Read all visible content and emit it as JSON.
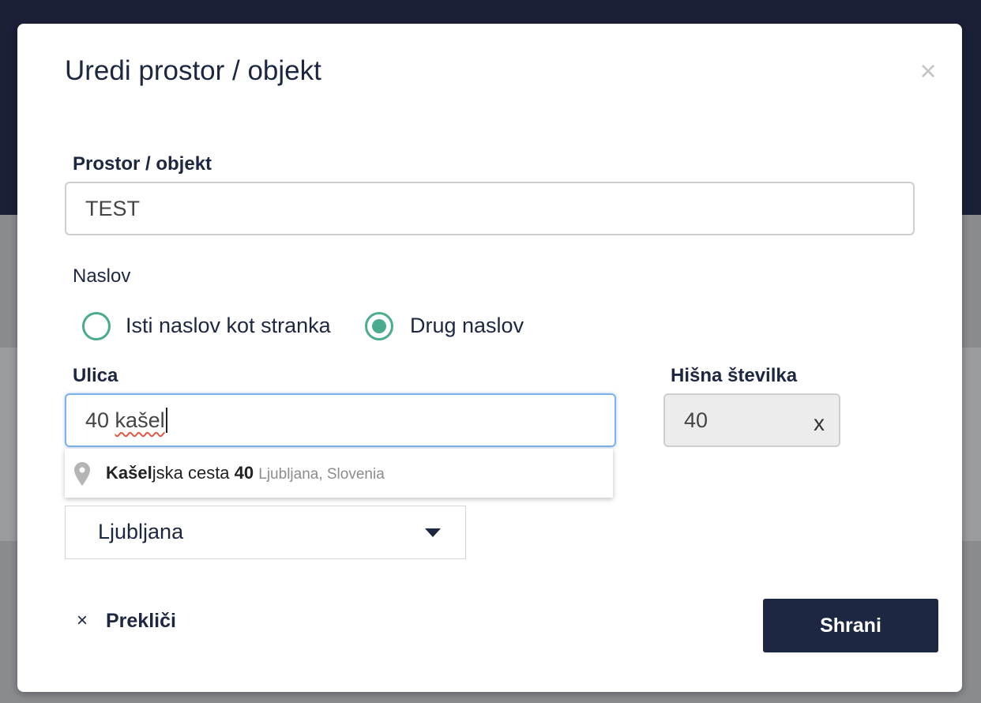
{
  "dialog": {
    "title": "Uredi prostor / objekt",
    "close_symbol": "×"
  },
  "fields": {
    "space_label": "Prostor / objekt",
    "space_value": "TEST",
    "address_label": "Naslov",
    "address_options": [
      {
        "label": "Isti naslov kot stranka",
        "selected": false
      },
      {
        "label": "Drug naslov",
        "selected": true
      }
    ],
    "street_label": "Ulica",
    "street_value_prefix": "40 ",
    "street_value_misspelled": "kašel",
    "house_number_label": "Hišna številka",
    "house_number_value": "40",
    "house_number_clear": "x",
    "city_value": "Ljubljana"
  },
  "autocomplete": {
    "match_bold": "Kašel",
    "rest": "jska cesta ",
    "number_bold": "40",
    "secondary": "Ljubljana, Slovenia",
    "icon": "map-pin-icon"
  },
  "footer": {
    "cancel_symbol": "×",
    "cancel_label": "Prekliči",
    "save_label": "Shrani"
  },
  "colors": {
    "primary": "#1e2741",
    "accent": "#4aab8e",
    "focus": "#7eb2e8"
  }
}
